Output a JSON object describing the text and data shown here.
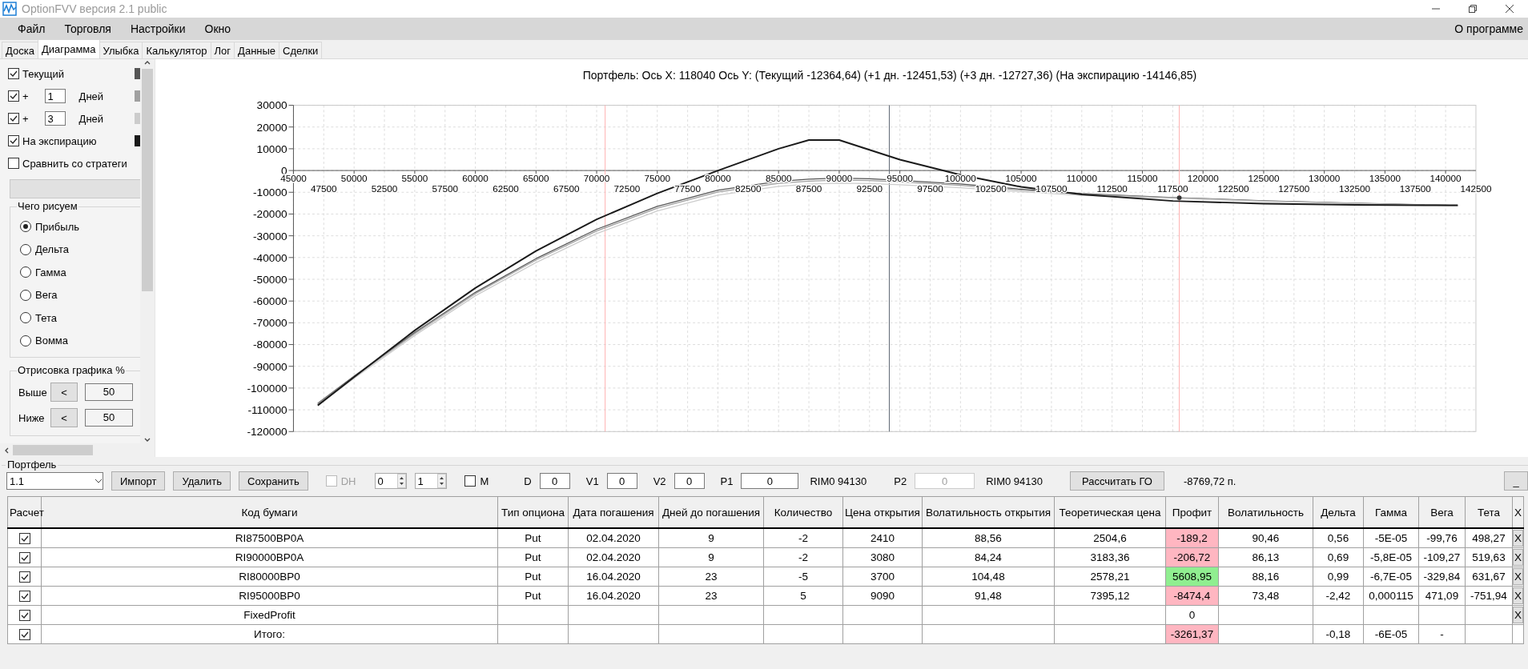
{
  "window": {
    "title": "OptionFVV версия 2.1 public"
  },
  "menu": [
    "Файл",
    "Торговля",
    "Настройки",
    "Окно"
  ],
  "menu_right": "О программе",
  "tabs": [
    {
      "label": "Доска",
      "selected": false
    },
    {
      "label": "Диаграмма",
      "selected": true
    },
    {
      "label": "Улыбка",
      "selected": false
    },
    {
      "label": "Калькулятор",
      "selected": false
    },
    {
      "label": "Лог",
      "selected": false
    },
    {
      "label": "Данные",
      "selected": false
    },
    {
      "label": "Сделки",
      "selected": false
    }
  ],
  "left_panel": {
    "toggles": [
      {
        "kind": "plain",
        "label": "Текущий",
        "checked": true,
        "color": "#555555"
      },
      {
        "kind": "days",
        "prefix": "+",
        "value": "1",
        "unit": "Дней",
        "checked": true,
        "color": "#a0a0a0"
      },
      {
        "kind": "days",
        "prefix": "+",
        "value": "3",
        "unit": "Дней",
        "checked": true,
        "color": "#cccccc"
      },
      {
        "kind": "plain",
        "label": "На экспирацию",
        "checked": true,
        "color": "#1a1a1a"
      },
      {
        "kind": "plain",
        "label": "Сравнить со стратеги",
        "checked": false
      }
    ],
    "draw_group": {
      "title": "Чего рисуем",
      "options": [
        {
          "label": "Прибыль",
          "selected": true
        },
        {
          "label": "Дельта",
          "selected": false
        },
        {
          "label": "Гамма",
          "selected": false
        },
        {
          "label": "Вега",
          "selected": false
        },
        {
          "label": "Тета",
          "selected": false
        },
        {
          "label": "Вомма",
          "selected": false
        }
      ]
    },
    "range_group": {
      "title": "Отрисовка графика %",
      "rows": [
        {
          "label": "Выше",
          "button": "<",
          "value": "50"
        },
        {
          "label": "Ниже",
          "button": "<",
          "value": "50"
        }
      ]
    }
  },
  "chart": {
    "caption": "Портфель: Ось X: 118040 Ось Y:  (Текущий -12364,64)  (+1 дн. -12451,53)  (+3 дн. -12727,36)  (На экспирацию -14146,85)",
    "lower_x_labels": [
      "47500",
      "52500",
      "57500",
      "62500",
      "67500",
      "72500",
      "77500",
      "82500",
      "87500",
      "92500",
      "97500",
      "102500",
      "107500",
      "112500",
      "117500",
      "122500",
      "127500",
      "132500",
      "137500",
      "142500"
    ],
    "chart_data": {
      "type": "line",
      "grid": true,
      "x": [
        47000,
        50000,
        55000,
        60000,
        65000,
        70000,
        75000,
        80000,
        85000,
        87500,
        90000,
        92500,
        95000,
        100000,
        105000,
        110000,
        117500,
        125000,
        132500,
        141000
      ],
      "series": [
        {
          "color": "#555555",
          "values": [
            -107000,
            -94500,
            -74500,
            -56000,
            -40500,
            -27000,
            -16500,
            -9000,
            -5000,
            -4000,
            -3500,
            -3800,
            -4500,
            -6200,
            -8600,
            -10600,
            -12400,
            -13900,
            -15000,
            -16100
          ]
        },
        {
          "color": "#a0a0a0",
          "values": [
            -107300,
            -94900,
            -75000,
            -56600,
            -41200,
            -27800,
            -17300,
            -9900,
            -5900,
            -4900,
            -4400,
            -4600,
            -5200,
            -6800,
            -9000,
            -10900,
            -12500,
            -14000,
            -15100,
            -16100
          ]
        },
        {
          "color": "#cccccc",
          "values": [
            -107800,
            -95500,
            -75800,
            -57600,
            -42300,
            -29000,
            -18600,
            -11300,
            -7300,
            -6300,
            -5800,
            -6000,
            -6500,
            -7900,
            -9800,
            -11400,
            -12800,
            -14200,
            -15200,
            -16200
          ]
        },
        {
          "color": "#1a1a1a",
          "values": [
            -108000,
            -95000,
            -73500,
            -54000,
            -37000,
            -22500,
            -10500,
            0,
            10000,
            14000,
            14000,
            9500,
            5000,
            -2000,
            -7500,
            -11000,
            -14000,
            -15200,
            -15800,
            -16000
          ]
        }
      ],
      "xlim": [
        45000,
        142500
      ],
      "ylim": [
        -120000,
        30000
      ],
      "ref_lines": [
        {
          "axis": "x",
          "value": 70700,
          "color": "#ffb0b0"
        },
        {
          "axis": "x",
          "value": 94130,
          "color": "#5a6470"
        },
        {
          "axis": "x",
          "value": 118040,
          "color": "#ffb0b0"
        }
      ],
      "xticks": [
        45000,
        50000,
        55000,
        60000,
        65000,
        70000,
        75000,
        80000,
        85000,
        90000,
        95000,
        100000,
        105000,
        110000,
        115000,
        120000,
        125000,
        130000,
        135000,
        140000
      ],
      "yticks": [
        30000,
        20000,
        10000,
        0,
        -10000,
        -20000,
        -30000,
        -40000,
        -50000,
        -60000,
        -70000,
        -80000,
        -90000,
        -100000,
        -110000,
        -120000
      ]
    }
  },
  "portfolio": {
    "title": "Портфель",
    "toolbar": [
      {
        "kind": "combo",
        "value": "1.1"
      },
      {
        "kind": "button",
        "label": "Импорт"
      },
      {
        "kind": "button",
        "label": "Удалить"
      },
      {
        "kind": "button",
        "label": "Сохранить"
      },
      {
        "kind": "checkbox",
        "label": "DH",
        "checked": false,
        "disabled": true
      },
      {
        "kind": "spinner",
        "value": "0"
      },
      {
        "kind": "spinner",
        "value": "1"
      },
      {
        "kind": "checkbox",
        "label": "M",
        "checked": false,
        "disabled": false
      },
      {
        "kind": "field",
        "label": "D",
        "value": "0",
        "disabled": false
      },
      {
        "kind": "field",
        "label": "V1",
        "value": "0",
        "disabled": false
      },
      {
        "kind": "field",
        "label": "V2",
        "value": "0",
        "disabled": false
      },
      {
        "kind": "field",
        "label": "P1",
        "value": "0",
        "disabled": false
      },
      {
        "kind": "text",
        "text": "RIM0 94130"
      },
      {
        "kind": "field",
        "label": "P2",
        "value": "0",
        "disabled": true
      },
      {
        "kind": "text",
        "text": "RIM0 94130"
      },
      {
        "kind": "button",
        "label": "Рассчитать ГО"
      },
      {
        "kind": "text",
        "text": "-8769,72 п."
      },
      {
        "kind": "button",
        "label": "_"
      }
    ],
    "table": {
      "calc_column": "Расчет",
      "delete_column": "X",
      "columns": [
        "Код бумаги",
        "Тип опциона",
        "Дата погашения",
        "Дней до погашения",
        "Количество",
        "Цена открытия",
        "Волатильность открытия",
        "Теоретическая цена",
        "Профит",
        "Волатильность",
        "Дельта",
        "Гамма",
        "Вега",
        "Тета"
      ],
      "rows": [
        {
          "calc": true,
          "color": "#ffb6c1",
          "delete": "X",
          "cells": [
            "RI87500BP0A",
            "Put",
            "02.04.2020",
            "9",
            "-2",
            "2410",
            "88,56",
            "2504,6",
            "-189,2",
            "90,46",
            "0,56",
            "-5E-05",
            "-99,76",
            "498,27"
          ]
        },
        {
          "calc": true,
          "color": "#ffb6c1",
          "delete": "X",
          "cells": [
            "RI90000BP0A",
            "Put",
            "02.04.2020",
            "9",
            "-2",
            "3080",
            "84,24",
            "3183,36",
            "-206,72",
            "86,13",
            "0,69",
            "-5,8E-05",
            "-109,27",
            "519,63"
          ]
        },
        {
          "calc": true,
          "color": "#90ee90",
          "delete": "X",
          "cells": [
            "RI80000BP0",
            "Put",
            "16.04.2020",
            "23",
            "-5",
            "3700",
            "104,48",
            "2578,21",
            "5608,95",
            "88,16",
            "0,99",
            "-6,7E-05",
            "-329,84",
            "631,67"
          ]
        },
        {
          "calc": true,
          "color": "#ffb6c1",
          "delete": "X",
          "cells": [
            "RI95000BP0",
            "Put",
            "16.04.2020",
            "23",
            "5",
            "9090",
            "91,48",
            "7395,12",
            "-8474,4",
            "73,48",
            "-2,42",
            "0,000115",
            "471,09",
            "-751,94"
          ]
        },
        {
          "calc": true,
          "delete": "X",
          "cells": [
            "FixedProfit",
            null,
            null,
            null,
            null,
            null,
            null,
            null,
            "0",
            null,
            null,
            null,
            null,
            null
          ]
        },
        {
          "calc": true,
          "color": "#ffb6c1",
          "cells": [
            "Итого:",
            null,
            null,
            null,
            null,
            null,
            null,
            null,
            "-3261,37",
            null,
            "-0,18",
            "-6E-05",
            "-",
            null
          ]
        }
      ]
    }
  }
}
